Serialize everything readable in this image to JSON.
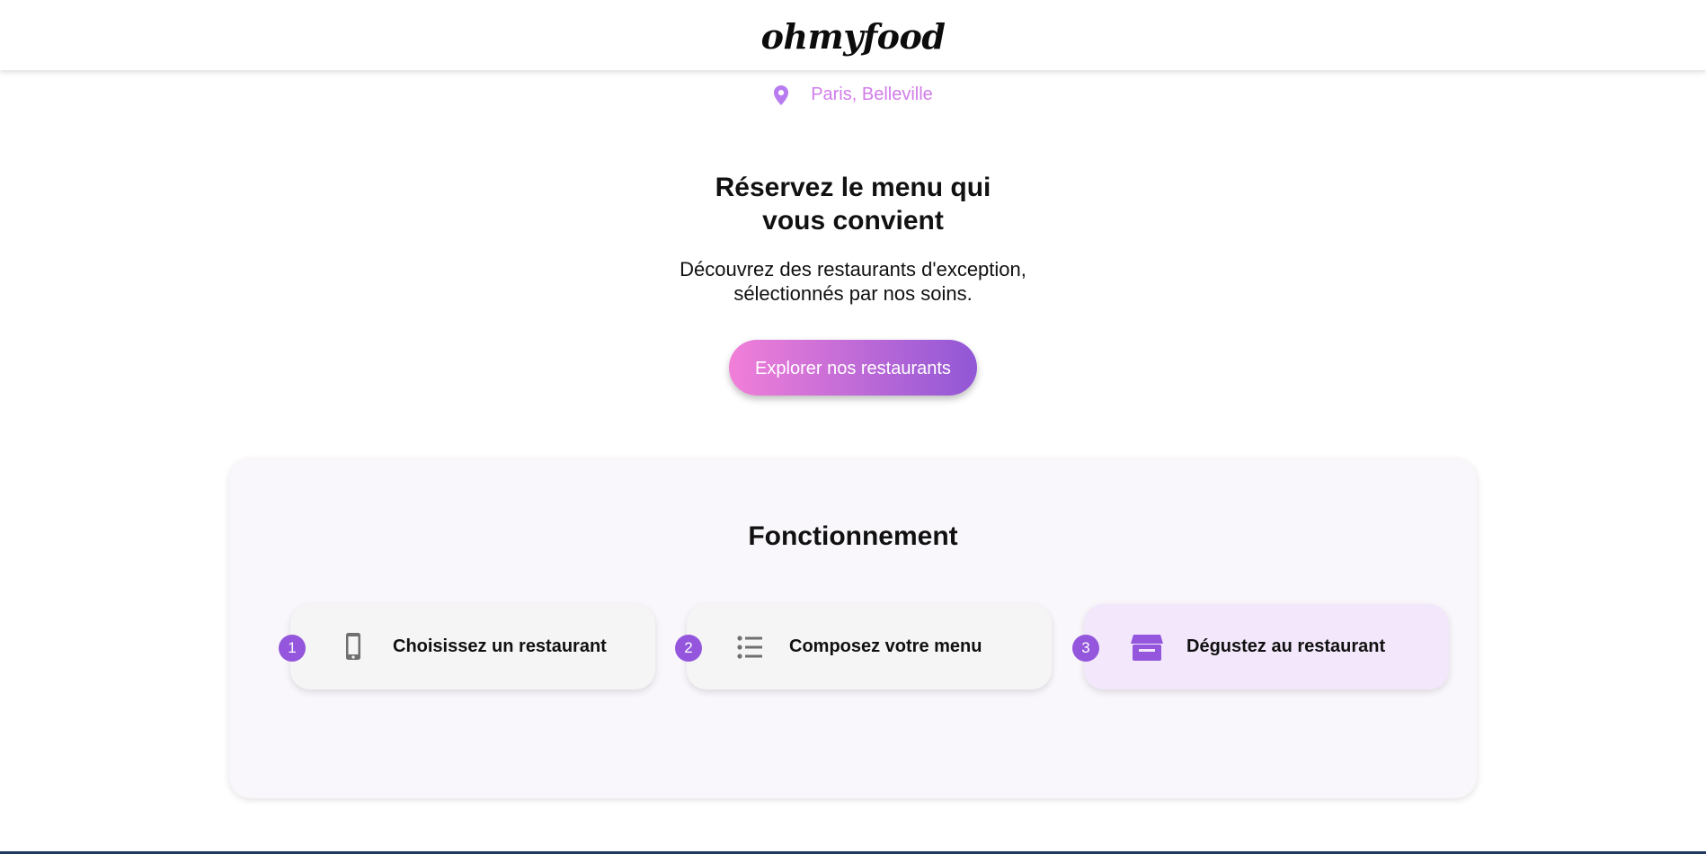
{
  "header": {
    "logo": "ohmyfood"
  },
  "location": {
    "icon": "map-pin-icon",
    "text": "Paris, Belleville"
  },
  "hero": {
    "title": "Réservez le menu qui vous convient",
    "subtitle": "Découvrez des restaurants d'exception, sélectionnés par nos soins.",
    "cta_label": "Explorer nos restaurants"
  },
  "how_it_works": {
    "title": "Fonctionnement",
    "steps": [
      {
        "number": "1",
        "icon": "phone-icon",
        "label": "Choisissez un restaurant"
      },
      {
        "number": "2",
        "icon": "list-icon",
        "label": "Composez votre menu"
      },
      {
        "number": "3",
        "icon": "store-icon",
        "label": "Dégustez au restaurant"
      }
    ]
  },
  "colors": {
    "accent_purple": "#9356dc",
    "accent_pink": "#f17fd8",
    "location_pink": "#d27cea"
  }
}
